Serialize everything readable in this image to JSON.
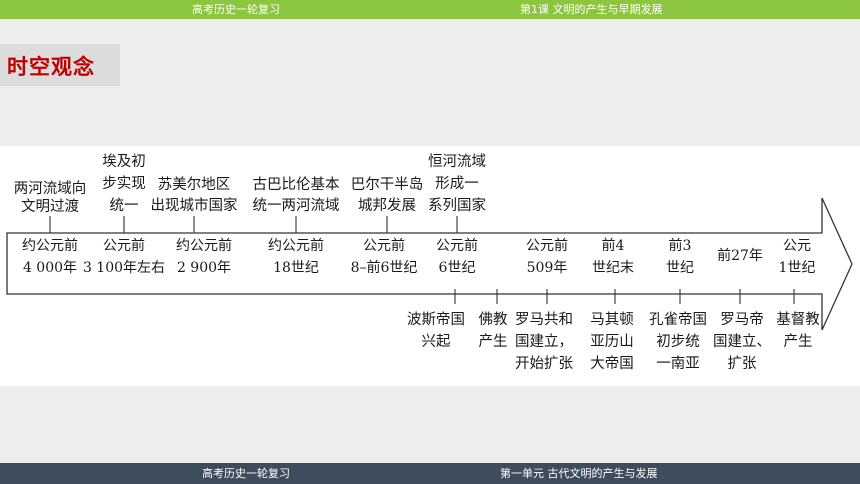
{
  "header": {
    "left_title": "高考历史一轮复习",
    "right_title": "第1课   文明的产生与早期发展"
  },
  "section_badge": "时空观念",
  "timeline": {
    "top_events": [
      {
        "lines": [
          "两河流域向",
          "文明过渡"
        ],
        "date": [
          "约公元前",
          "4 000年"
        ]
      },
      {
        "lines": [
          "埃及初",
          "步实现",
          "统一"
        ],
        "date": [
          "公元前",
          "3 100年左右"
        ]
      },
      {
        "lines": [
          "苏美尔地区",
          "出现城市国家"
        ],
        "date": [
          "约公元前",
          "2 900年"
        ]
      },
      {
        "lines": [
          "古巴比伦基本",
          "统一两河流域"
        ],
        "date": [
          "约公元前",
          "18世纪"
        ]
      },
      {
        "lines": [
          "巴尔干半岛",
          "城邦发展"
        ],
        "date": [
          "公元前",
          "8–前6世纪"
        ]
      },
      {
        "lines": [
          "恒河流域",
          "形成一",
          "系列国家"
        ],
        "date": [
          "公元前",
          "6世纪"
        ]
      }
    ],
    "bottom_events": [
      {
        "lines": [
          "波斯帝国",
          "兴起"
        ],
        "date": [
          "公元前",
          "6世纪"
        ]
      },
      {
        "lines": [
          "佛教",
          "产生"
        ],
        "date": [
          "公元前",
          "6世纪"
        ]
      },
      {
        "lines": [
          "罗马共和",
          "国建立，",
          "开始扩张"
        ],
        "date": [
          "公元前",
          "509年"
        ]
      },
      {
        "lines": [
          "马其顿",
          "亚历山",
          "大帝国"
        ],
        "date": [
          "前4",
          "世纪末"
        ]
      },
      {
        "lines": [
          "孔雀帝国",
          "初步统",
          "一南亚"
        ],
        "date": [
          "前3",
          "世纪"
        ]
      },
      {
        "lines": [
          "罗马帝",
          "国建立、",
          "扩张"
        ],
        "date": [
          "前27年"
        ]
      },
      {
        "lines": [
          "基督教",
          "产生"
        ],
        "date": [
          "公元",
          "1世纪"
        ]
      }
    ]
  },
  "footer": {
    "left_title": "高考历史一轮复习",
    "right_title": "第一单元    古代文明的产生与发展"
  }
}
